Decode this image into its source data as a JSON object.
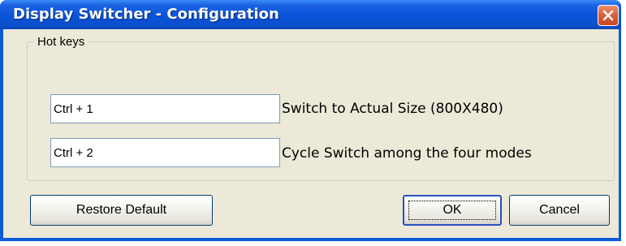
{
  "window": {
    "title": "Display Switcher - Configuration"
  },
  "icons": {
    "close": "close-icon"
  },
  "hotkeys": {
    "group_label": "Hot keys",
    "items": [
      {
        "value": "Ctrl + 1",
        "description": "Switch to Actual Size (800X480)"
      },
      {
        "value": "Ctrl + 2",
        "description": "Cycle Switch among the four modes"
      }
    ]
  },
  "buttons": {
    "restore_default": "Restore Default",
    "ok": "OK",
    "cancel": "Cancel"
  },
  "colors": {
    "titlebar": "#0a54d8",
    "close_button": "#dd5f3d",
    "dialog_background": "#ece9d8",
    "default_button_border": "#2b4fc1"
  }
}
